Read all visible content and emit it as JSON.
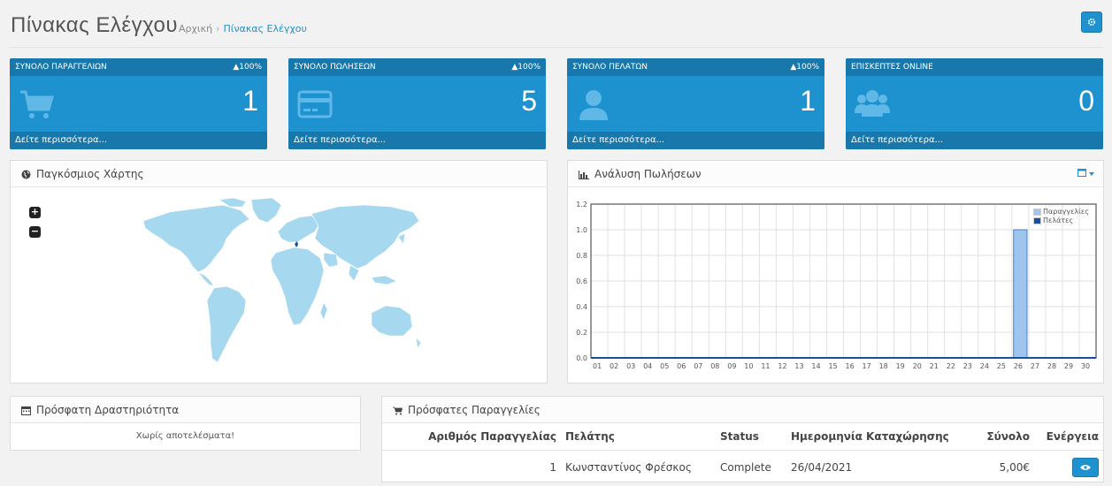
{
  "header": {
    "title": "Πίνακας Ελέγχου",
    "breadcrumb": [
      "Αρχική",
      "Πίνακας Ελέγχου"
    ],
    "settings_icon": "gear-icon"
  },
  "tiles": [
    {
      "label": "ΣΥΝΟΛΟ ΠΑΡΑΓΓΕΛΙΩΝ",
      "pct": "▲100%",
      "value": "1",
      "link": "Δείτε περισσότερα...",
      "icon": "cart-icon"
    },
    {
      "label": "ΣΥΝΟΛΟ ΠΩΛΗΣΕΩΝ",
      "pct": "▲100%",
      "value": "5",
      "link": "Δείτε περισσότερα...",
      "icon": "credit-card-icon"
    },
    {
      "label": "ΣΥΝΟΛΟ ΠΕΛΑΤΩΝ",
      "pct": "▲100%",
      "value": "1",
      "link": "Δείτε περισσότερα...",
      "icon": "user-icon"
    },
    {
      "label": "ΕΠΙΣΚΕΠΤΕΣ ONLINE",
      "pct": "",
      "value": "0",
      "link": "Δείτε περισσότερα...",
      "icon": "users-icon"
    }
  ],
  "map_panel": {
    "title": "Παγκόσμιος Χάρτης",
    "zoom_in": "+",
    "zoom_out": "−"
  },
  "chart_panel": {
    "title": "Ανάλυση Πωλήσεων"
  },
  "activity_panel": {
    "title": "Πρόσφατη Δραστηριότητα",
    "empty": "Χωρίς αποτελέσματα!"
  },
  "orders_panel": {
    "title": "Πρόσφατες Παραγγελίες",
    "columns": [
      "Αριθμός Παραγγελίας",
      "Πελάτης",
      "Status",
      "Ημερομηνία Καταχώρησης",
      "Σύνολο",
      "Ενέργεια"
    ],
    "rows": [
      {
        "id": "1",
        "customer": "Κωνσταντίνος Φρέσκος",
        "status": "Complete",
        "date": "26/04/2021",
        "total": "5,00€"
      }
    ]
  },
  "colors": {
    "accent": "#1e91cf",
    "accent_dark": "#1978ab",
    "map_land": "#a6d8f0",
    "bar_orders": "#9fc5ef",
    "bar_customers": "#1a4fa0"
  },
  "chart_data": {
    "type": "bar",
    "categories": [
      "01",
      "02",
      "03",
      "04",
      "05",
      "06",
      "07",
      "08",
      "09",
      "10",
      "11",
      "12",
      "13",
      "14",
      "15",
      "16",
      "17",
      "18",
      "19",
      "20",
      "21",
      "22",
      "23",
      "24",
      "25",
      "26",
      "27",
      "28",
      "29",
      "30"
    ],
    "series": [
      {
        "name": "Παραγγελίες",
        "values": [
          0,
          0,
          0,
          0,
          0,
          0,
          0,
          0,
          0,
          0,
          0,
          0,
          0,
          0,
          0,
          0,
          0,
          0,
          0,
          0,
          0,
          0,
          0,
          0,
          0,
          1,
          0,
          0,
          0,
          0
        ]
      },
      {
        "name": "Πελάτες",
        "values": [
          0,
          0,
          0,
          0,
          0,
          0,
          0,
          0,
          0,
          0,
          0,
          0,
          0,
          0,
          0,
          0,
          0,
          0,
          0,
          0,
          0,
          0,
          0,
          0,
          0,
          0,
          0,
          0,
          0,
          0
        ]
      }
    ],
    "yticks": [
      "0.0",
      "0.2",
      "0.4",
      "0.6",
      "0.8",
      "1.0",
      "1.2"
    ],
    "ylim": [
      0,
      1.2
    ],
    "grid": true,
    "legend": "top-right"
  }
}
